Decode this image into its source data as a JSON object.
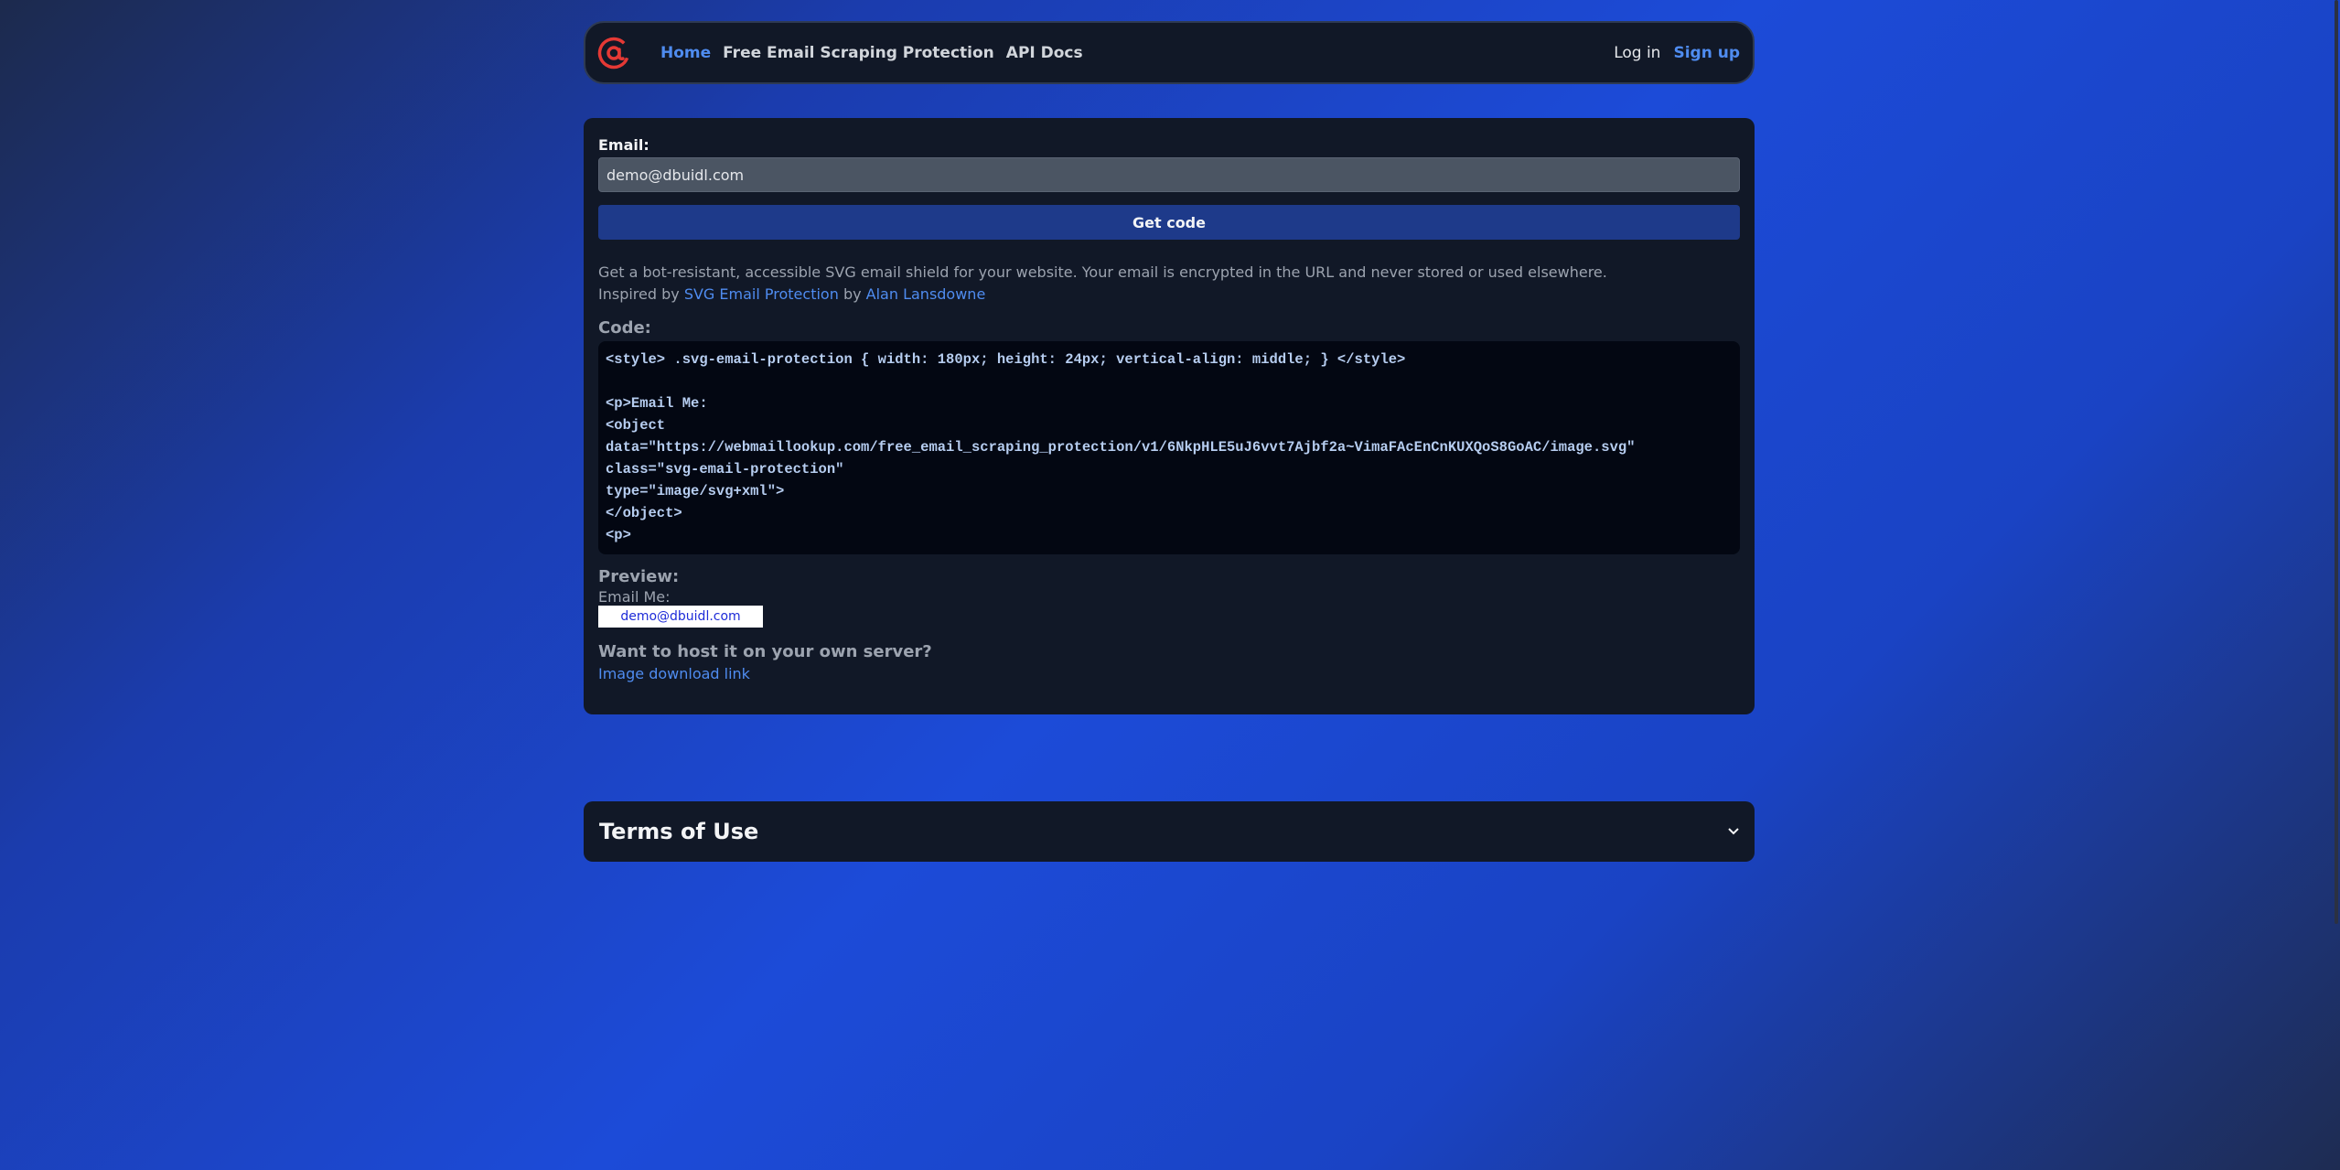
{
  "nav": {
    "logo_icon": "at-sign-icon",
    "links": [
      {
        "label": "Home",
        "active": true
      },
      {
        "label": "Free Email Scraping Protection",
        "active": false
      },
      {
        "label": "API Docs",
        "active": false
      }
    ],
    "login": "Log in",
    "signup": "Sign up"
  },
  "form": {
    "email_label": "Email:",
    "email_value": "demo@dbuidl.com",
    "button_label": "Get code"
  },
  "description": {
    "line1": "Get a bot-resistant, accessible SVG email shield for your website. Your email is encrypted in the URL and never stored or used elsewhere.",
    "inspired_prefix": "Inspired by",
    "inspired_link": "SVG Email Protection",
    "by": "by",
    "author_link": "Alan Lansdowne"
  },
  "code": {
    "label": "Code:",
    "text": "<style> .svg-email-protection { width: 180px; height: 24px; vertical-align: middle; } </style>\n\n<p>Email Me:\n<object\ndata=\"https://webmaillookup.com/free_email_scraping_protection/v1/6NkpHLE5uJ6vvt7Ajbf2a~VimaFAcEnCnKUXQoS8GoAC/image.svg\"\nclass=\"svg-email-protection\"\ntype=\"image/svg+xml\">\n</object>\n<p>"
  },
  "preview": {
    "label": "Preview:",
    "email_me": "Email Me:",
    "shield_text": "demo@dbuidl.com"
  },
  "host": {
    "label": "Want to host it on your own server?",
    "link": "Image download link"
  },
  "terms": {
    "title": "Terms of Use",
    "icon": "chevron-down-icon"
  },
  "colors": {
    "accent": "#4f8cf0",
    "logo_red": "#e53935",
    "panel": "#111827"
  }
}
